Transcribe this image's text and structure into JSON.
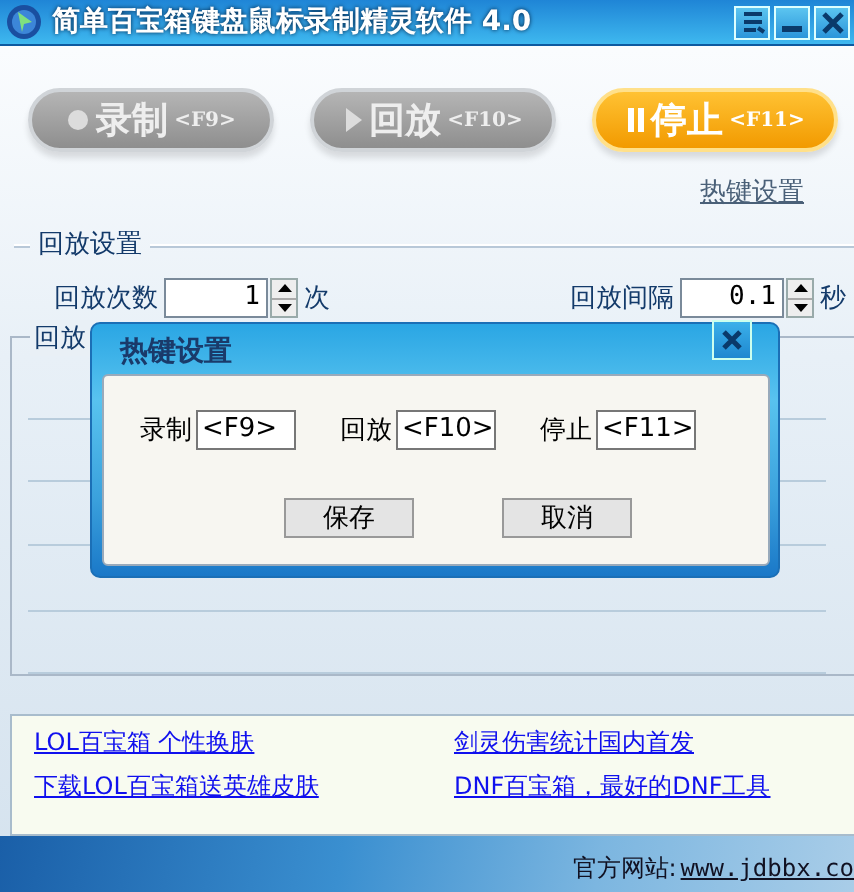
{
  "window": {
    "title": "简单百宝箱键盘鼠标录制精灵软件 4.0"
  },
  "main_buttons": [
    {
      "label": "录制",
      "key": "<F9>",
      "kind": "record",
      "disabled": true
    },
    {
      "label": "回放",
      "key": "<F10>",
      "kind": "play",
      "disabled": true
    },
    {
      "label": "停止",
      "key": "<F11>",
      "kind": "stop",
      "disabled": false
    }
  ],
  "hotkey_link": "热键设置",
  "playback_settings": {
    "title": "回放设置",
    "count_label": "回放次数",
    "count_value": "1",
    "count_unit": "次",
    "interval_label": "回放间隔",
    "interval_value": "0.1",
    "interval_unit": "秒"
  },
  "second_group": {
    "title": "回放"
  },
  "dialog": {
    "title": "热键设置",
    "fields": [
      {
        "label": "录制",
        "value": "<F9>"
      },
      {
        "label": "回放",
        "value": "<F10>"
      },
      {
        "label": "停止",
        "value": "<F11>"
      }
    ],
    "buttons": [
      "保存",
      "取消"
    ]
  },
  "links": [
    "LOL百宝箱 个性换肤",
    "剑灵伤害统计国内首发",
    "下载LOL百宝箱送英雄皮肤",
    "DNF百宝箱，最好的DNF工具"
  ],
  "footer": {
    "label": "官方网站:",
    "url": "www.jdbbx.co"
  }
}
